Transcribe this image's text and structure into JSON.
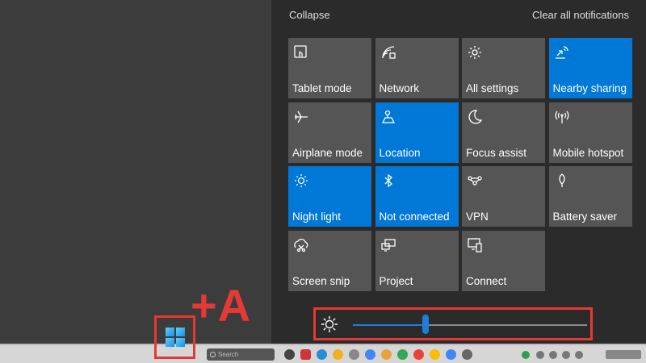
{
  "action_center": {
    "collapse_label": "Collapse",
    "clear_all_label": "Clear all notifications",
    "tiles": [
      {
        "label": "Tablet mode",
        "icon": "tablet-mode-icon",
        "active": false
      },
      {
        "label": "Network",
        "icon": "network-icon",
        "active": false
      },
      {
        "label": "All settings",
        "icon": "gear-icon",
        "active": false
      },
      {
        "label": "Nearby sharing",
        "icon": "nearby-sharing-icon",
        "active": true
      },
      {
        "label": "Airplane mode",
        "icon": "airplane-icon",
        "active": false
      },
      {
        "label": "Location",
        "icon": "location-icon",
        "active": true
      },
      {
        "label": "Focus assist",
        "icon": "moon-icon",
        "active": false
      },
      {
        "label": "Mobile hotspot",
        "icon": "hotspot-icon",
        "active": false
      },
      {
        "label": "Night light",
        "icon": "night-light-icon",
        "active": true
      },
      {
        "label": "Not connected",
        "icon": "bluetooth-icon",
        "active": true
      },
      {
        "label": "VPN",
        "icon": "vpn-icon",
        "active": false
      },
      {
        "label": "Battery saver",
        "icon": "battery-saver-icon",
        "active": false
      },
      {
        "label": "Screen snip",
        "icon": "screen-snip-icon",
        "active": false
      },
      {
        "label": "Project",
        "icon": "project-icon",
        "active": false
      },
      {
        "label": "Connect",
        "icon": "connect-icon",
        "active": false
      }
    ],
    "brightness": {
      "icon": "brightness-icon",
      "level_percent": 31
    }
  },
  "annotation": {
    "shortcut_text": "+A",
    "highlight_color": "#e53935"
  },
  "taskbar": {
    "start_icon": "windows-logo-icon",
    "search_placeholder": "Search"
  },
  "colors": {
    "tile": "#555555",
    "tile_active": "#0078d7",
    "panel": "#2b2b2b",
    "desktop": "#3c3c3c"
  }
}
